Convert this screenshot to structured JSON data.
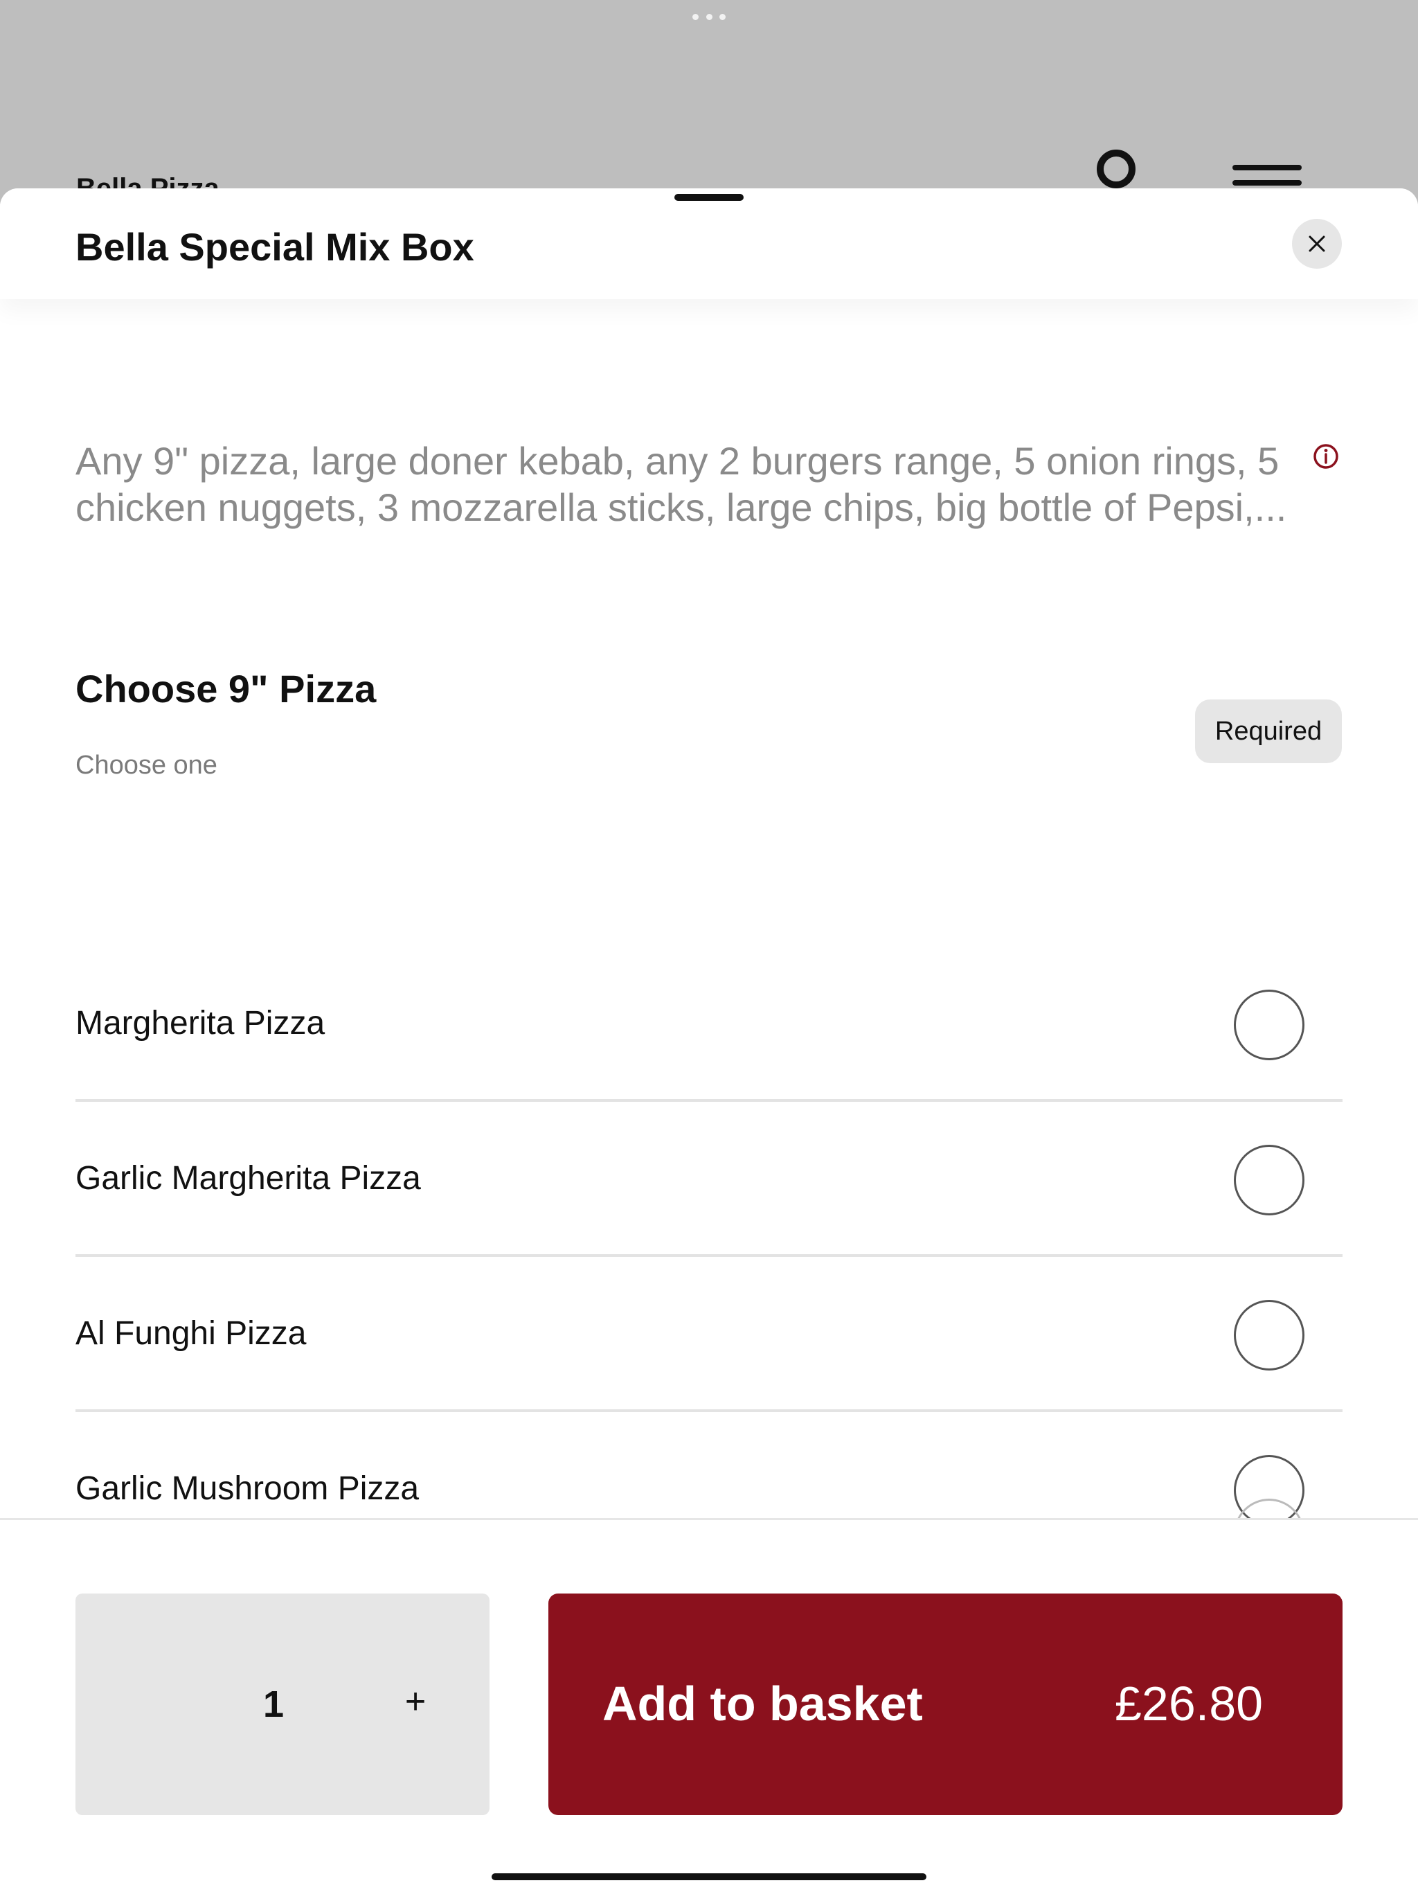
{
  "background": {
    "brand": "Bella Pizza"
  },
  "sheet": {
    "title": "Bella Special Mix Box",
    "description": "Any 9\" pizza, large doner kebab, any 2 burgers range, 5 onion rings, 5 chicken nuggets, 3 mozzarella sticks, large chips, big bottle of Pepsi,...",
    "section": {
      "title": "Choose 9\" Pizza",
      "subtitle": "Choose one",
      "badge": "Required",
      "options": [
        {
          "label": "Margherita Pizza"
        },
        {
          "label": "Garlic Margherita Pizza"
        },
        {
          "label": "Al Funghi Pizza"
        },
        {
          "label": "Garlic Mushroom Pizza"
        }
      ]
    }
  },
  "footer": {
    "quantity": "1",
    "plus": "+",
    "add_label": "Add to basket",
    "price": "£26.80"
  },
  "colors": {
    "accent": "#8b111d",
    "muted_bg": "#e6e6e6"
  },
  "icons": {
    "close": "close-icon",
    "info": "info-icon",
    "account": "account-icon",
    "menu": "menu-icon"
  }
}
